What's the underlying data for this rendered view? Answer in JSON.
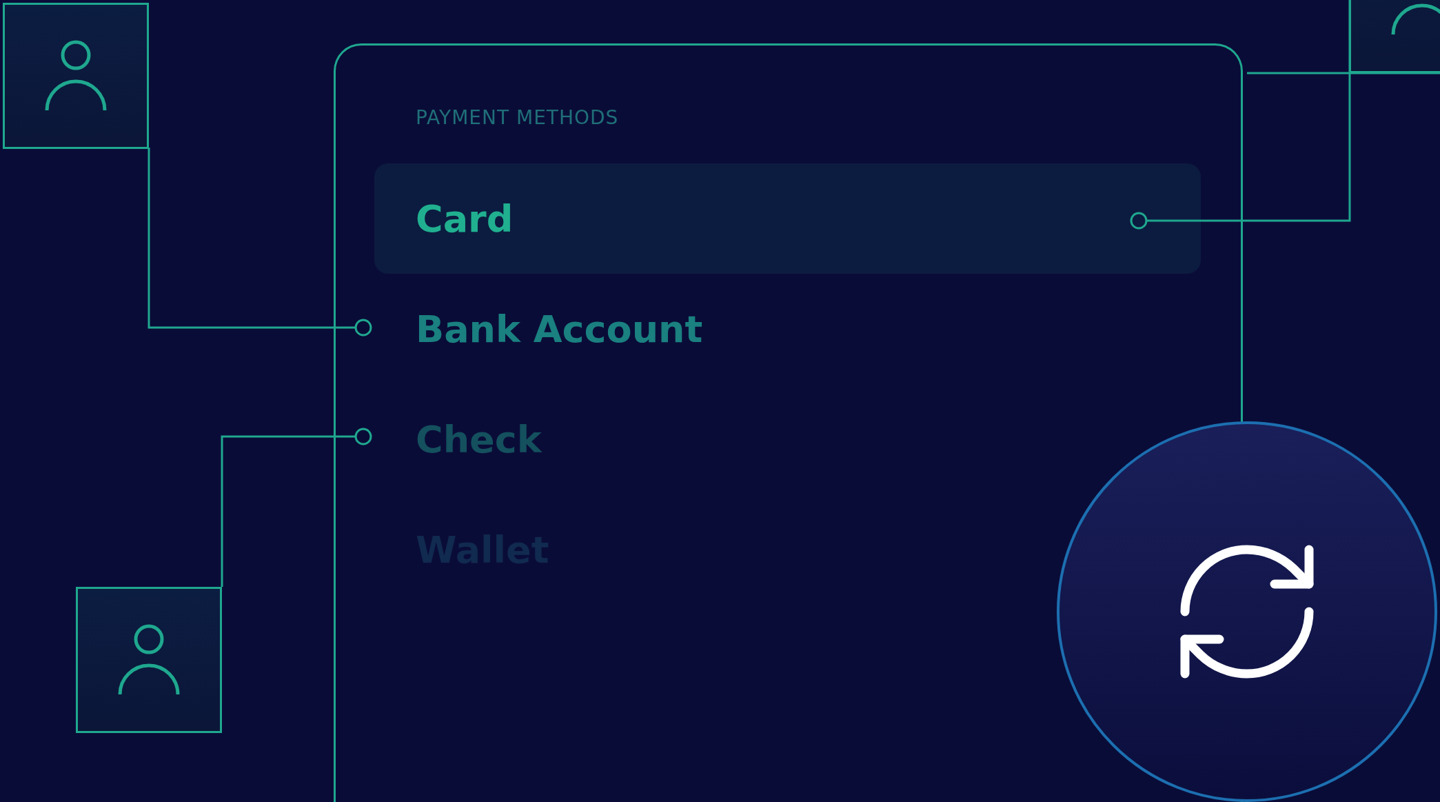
{
  "panel": {
    "heading": "PAYMENT METHODS",
    "options": [
      {
        "label": "Card",
        "selected": true,
        "kind": "strong"
      },
      {
        "label": "Bank Account",
        "selected": false,
        "kind": "medium"
      },
      {
        "label": "Check",
        "selected": false,
        "kind": "dim"
      },
      {
        "label": "Wallet",
        "selected": false,
        "kind": "faint"
      }
    ]
  }
}
